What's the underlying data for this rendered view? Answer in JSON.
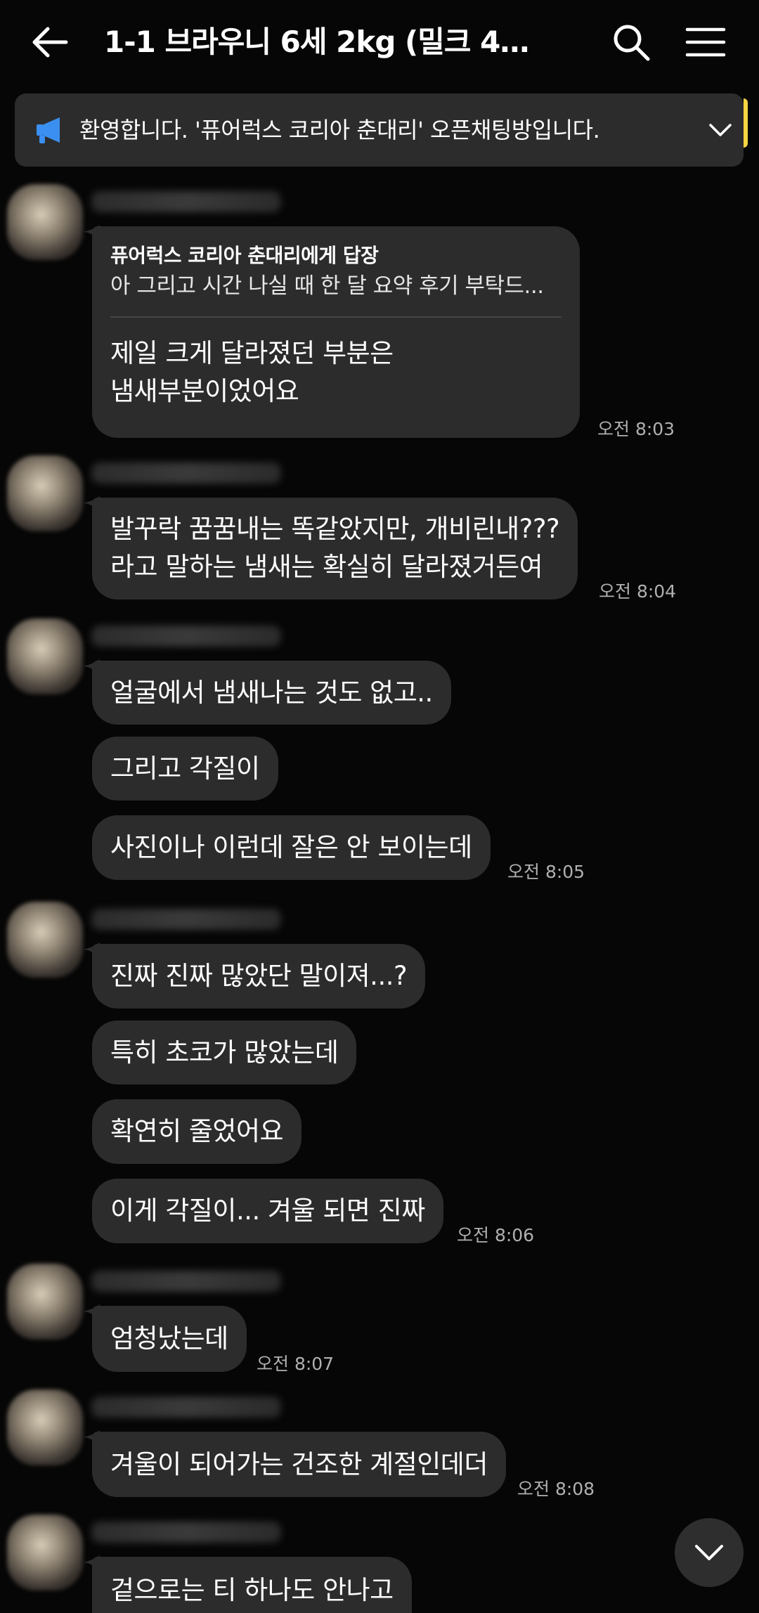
{
  "header": {
    "title": "1-1 브라우니 6세 2kg (밀크 4세..."
  },
  "notice": {
    "text": "환영합니다. '퓨어럭스 코리아 춘대리' 오픈채팅방입니다."
  },
  "messages": {
    "m1_reply_head": "퓨어럭스 코리아 춘대리에게 답장",
    "m1_reply_quote": "아 그리고 시간 나실 때 한 달 요약 후기 부탁드...",
    "m1_line1": "제일 크게 달라졌던 부분은",
    "m1_line2": "냄새부분이었어요",
    "t1": "오전 8:03",
    "m2_line1": "발꾸락 꿈꿈내는 똑같았지만, 개비린내???",
    "m2_line2": "라고 말하는 냄새는 확실히 달라졌거든여",
    "t2": "오전 8:04",
    "m3": "얼굴에서 냄새나는 것도 없고..",
    "m4": "그리고 각질이",
    "m5": "사진이나 이런데 잘은 안 보이는데",
    "t3": "오전 8:05",
    "m6": "진짜 진짜 많았단 말이져...?",
    "m7": "특히 초코가 많았는데",
    "m8": "확연히 줄었어요",
    "m9": "이게 각질이... 겨울 되면 진짜",
    "t4": "오전 8:06",
    "m10": "엄청났는데",
    "t5": "오전 8:07",
    "m11": "겨울이 되어가는 건조한 계절인데더",
    "t6": "오전 8:08",
    "m12": "겉으로는 티 하나도 안나고"
  },
  "colors": {
    "background": "#060606",
    "bubble": "#2c2c2c",
    "notice_icon": "#3b8ff0",
    "timestamp": "#b0b0b0"
  },
  "icons": {
    "back": "arrow-left-icon",
    "search": "search-icon",
    "menu": "hamburger-menu-icon",
    "notice": "megaphone-icon",
    "expand": "chevron-down-icon",
    "scroll": "chevron-down-icon"
  }
}
